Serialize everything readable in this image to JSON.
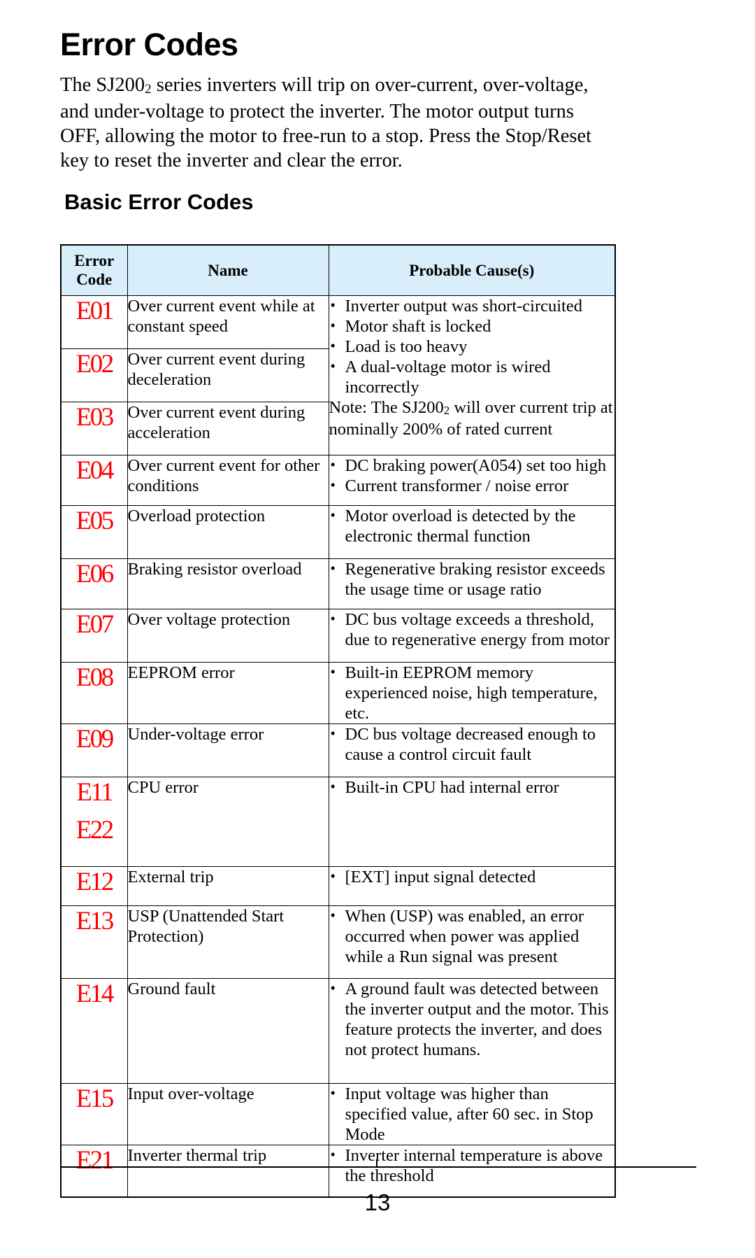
{
  "document": {
    "title": "Error Codes",
    "intro_before_sub": "The SJ200",
    "intro_sub": "2",
    "intro_after_sub": " series inverters will trip on over-current, over-voltage, and under-voltage to protect the inverter. The motor output turns OFF, allowing the motor to free-run to a stop. Press the Stop/Reset key to reset the inverter and clear the error.",
    "section_title": "Basic Error Codes",
    "page_number": "13"
  },
  "table": {
    "headers": {
      "code_line1": "Error",
      "code_line2": "Code",
      "name": "Name",
      "cause": "Probable Cause(s)"
    },
    "rows": [
      {
        "code": "E01",
        "code2": "",
        "name_lines": [
          "Over current event while at",
          "constant speed"
        ],
        "causes": [
          "Inverter output was short-circuited",
          "Motor shaft is locked",
          "Load is too heavy",
          "A dual-voltage motor is wired incorrectly"
        ],
        "note_before_sub": "Note: The SJ200",
        "note_sub": "2",
        "note_after_sub": " will over current trip at nominally 200% of rated current"
      },
      {
        "code": "E02",
        "code2": "",
        "name_lines": [
          "Over current event during",
          "deceleration"
        ],
        "causes": [],
        "note_before_sub": "",
        "note_sub": "",
        "note_after_sub": ""
      },
      {
        "code": "E03",
        "code2": "",
        "name_lines": [
          "Over current event during",
          "acceleration"
        ],
        "causes": [],
        "note_before_sub": "",
        "note_sub": "",
        "note_after_sub": ""
      },
      {
        "code": "E04",
        "code2": "",
        "name_lines": [
          "Over current event for other",
          "conditions"
        ],
        "causes": [
          "DC braking power(A054) set too high",
          "Current transformer / noise error"
        ],
        "note_before_sub": "",
        "note_sub": "",
        "note_after_sub": ""
      },
      {
        "code": "E05",
        "code2": "",
        "name_lines": [
          "Overload protection"
        ],
        "causes": [
          "Motor overload is detected by the electronic thermal function"
        ],
        "note_before_sub": "",
        "note_sub": "",
        "note_after_sub": ""
      },
      {
        "code": "E06",
        "code2": "",
        "name_lines": [
          "Braking resistor overload"
        ],
        "causes": [
          "Regenerative braking resistor exceeds the usage time or usage ratio"
        ],
        "note_before_sub": "",
        "note_sub": "",
        "note_after_sub": ""
      },
      {
        "code": "E07",
        "code2": "",
        "name_lines": [
          "Over voltage protection"
        ],
        "causes": [
          "DC bus voltage exceeds a threshold, due to regenerative energy from motor"
        ],
        "note_before_sub": "",
        "note_sub": "",
        "note_after_sub": ""
      },
      {
        "code": "E08",
        "code2": "",
        "name_lines": [
          "EEPROM error"
        ],
        "causes": [
          "Built-in EEPROM memory experienced noise, high temperature, etc."
        ],
        "note_before_sub": "",
        "note_sub": "",
        "note_after_sub": ""
      },
      {
        "code": "E09",
        "code2": "",
        "name_lines": [
          "Under-voltage error"
        ],
        "causes": [
          "DC bus voltage decreased enough to cause a control circuit fault"
        ],
        "note_before_sub": "",
        "note_sub": "",
        "note_after_sub": ""
      },
      {
        "code": "E11",
        "code2": "E22",
        "name_lines": [
          "CPU error"
        ],
        "causes": [
          "Built-in CPU had internal error"
        ],
        "note_before_sub": "",
        "note_sub": "",
        "note_after_sub": ""
      },
      {
        "code": "E12",
        "code2": "",
        "name_lines": [
          "External trip"
        ],
        "causes": [
          "[EXT] input signal detected"
        ],
        "note_before_sub": "",
        "note_sub": "",
        "note_after_sub": ""
      },
      {
        "code": "E13",
        "code2": "",
        "name_lines": [
          "USP (Unattended Start",
          "Protection)"
        ],
        "causes": [
          "When (USP) was enabled, an error occurred when power was applied while a Run signal was present"
        ],
        "note_before_sub": "",
        "note_sub": "",
        "note_after_sub": ""
      },
      {
        "code": "E14",
        "code2": "",
        "name_lines": [
          "Ground fault"
        ],
        "causes": [
          "A ground fault was detected between the inverter output and the motor. This feature protects the inverter, and does not protect humans."
        ],
        "note_before_sub": "",
        "note_sub": "",
        "note_after_sub": ""
      },
      {
        "code": "E15",
        "code2": "",
        "name_lines": [
          "Input over-voltage"
        ],
        "causes": [
          "Input voltage was higher than specified value, after 60 sec. in Stop Mode"
        ],
        "note_before_sub": "",
        "note_sub": "",
        "note_after_sub": ""
      },
      {
        "code": "E21",
        "code2": "",
        "name_lines": [
          "Inverter thermal trip"
        ],
        "causes": [
          "Inverter internal temperature is above the threshold"
        ],
        "note_before_sub": "",
        "note_sub": "",
        "note_after_sub": ""
      }
    ]
  }
}
